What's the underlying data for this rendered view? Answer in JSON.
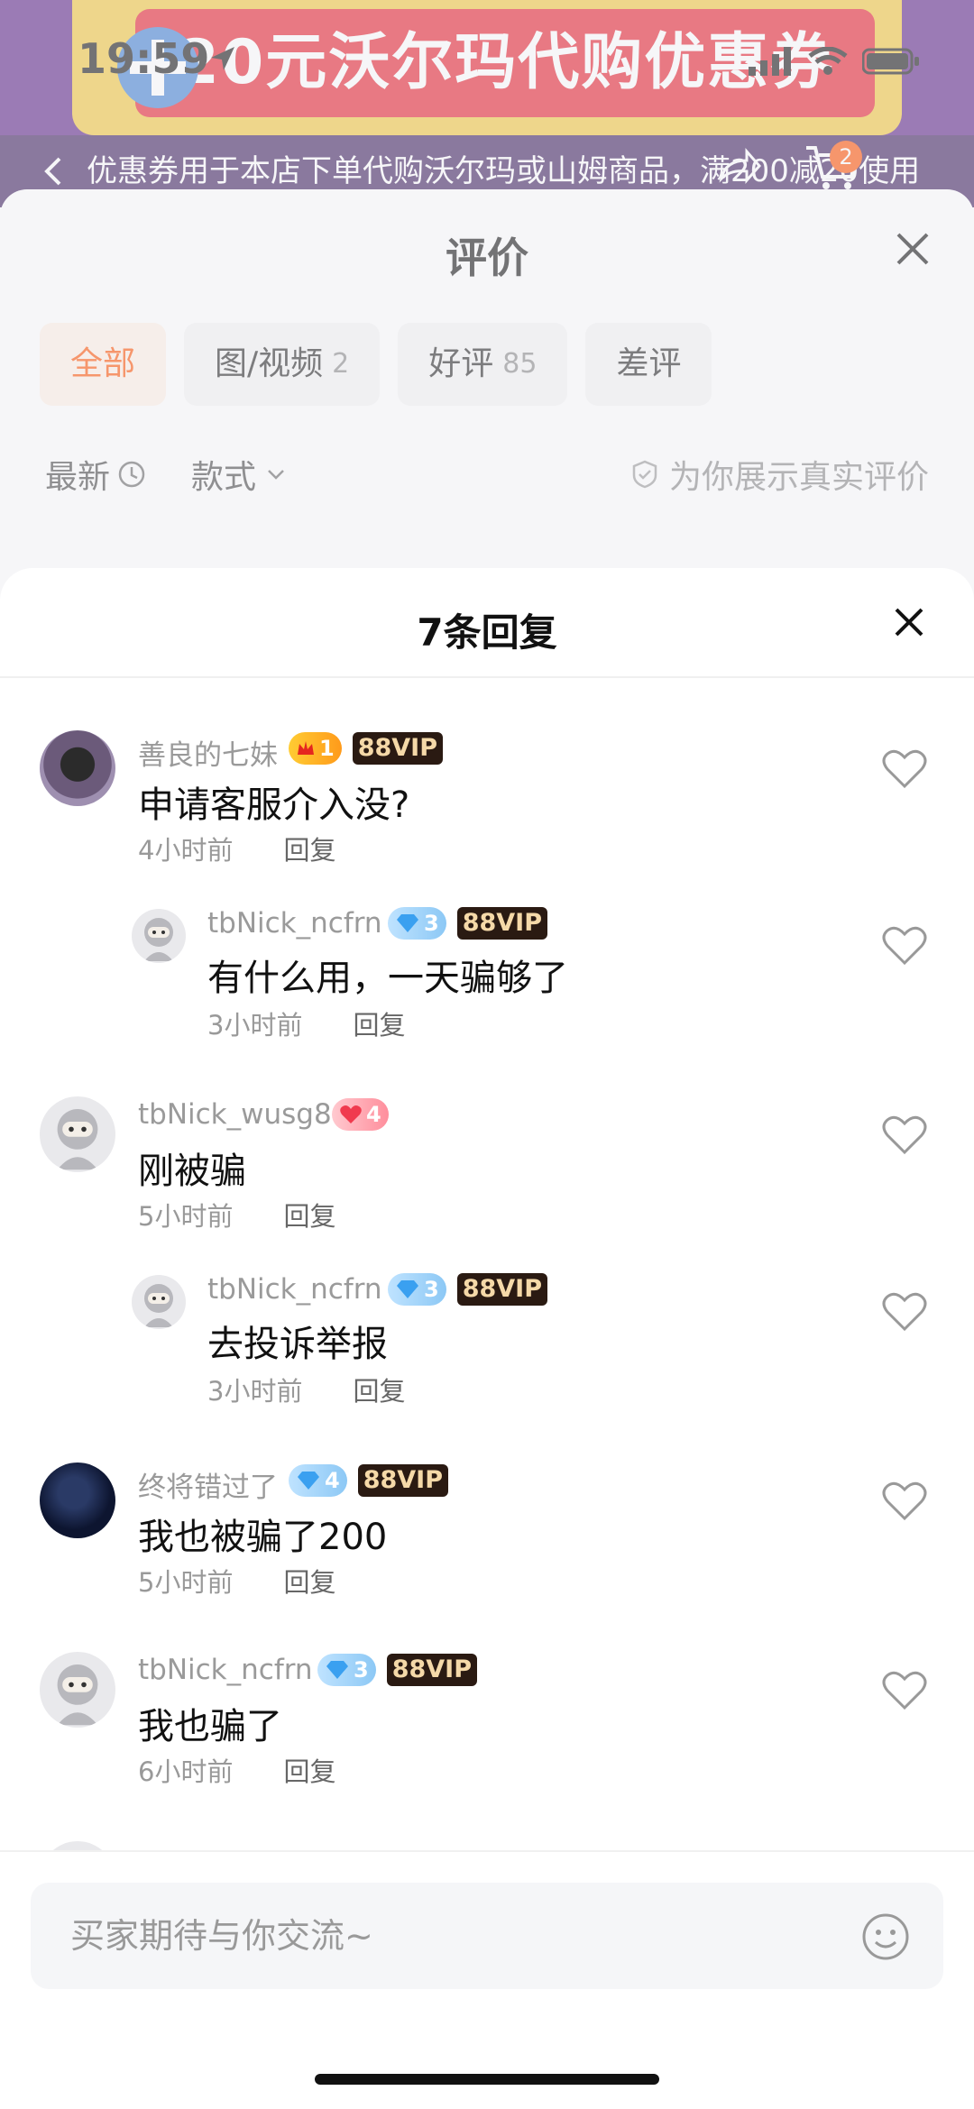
{
  "status_bar": {
    "time": "19:59"
  },
  "background": {
    "promo_banner": "20元沃尔玛代购优惠券",
    "subbar_text": "优惠券用于本店下单代购沃尔玛或山姆商品，满200减20使用",
    "cart_count": "2",
    "review_sheet": {
      "title": "评价",
      "tabs": [
        {
          "label": "全部",
          "count": ""
        },
        {
          "label": "图/视频",
          "count": "2"
        },
        {
          "label": "好评",
          "count": "85"
        },
        {
          "label": "差评",
          "count": ""
        }
      ],
      "filter_latest": "最新",
      "filter_style": "款式",
      "real_reviews": "为你展示真实评价"
    }
  },
  "reply_sheet": {
    "title": "7条回复",
    "comments": [
      {
        "user": "善良的七妹",
        "level": "1",
        "vip": "88VIP",
        "text": "申请客服介入没?",
        "time": "4小时前",
        "reply": "回复"
      },
      {
        "user": "tbNick_ncfrn",
        "level": "3",
        "vip": "88VIP",
        "text": "有什么用，一天骗够了",
        "time": "3小时前",
        "reply": "回复"
      },
      {
        "user": "tbNick_wusg8",
        "level": "4",
        "vip": "",
        "text": "刚被骗",
        "time": "5小时前",
        "reply": "回复"
      },
      {
        "user": "tbNick_ncfrn",
        "level": "3",
        "vip": "88VIP",
        "text": "去投诉举报",
        "time": "3小时前",
        "reply": "回复"
      },
      {
        "user": "终将错过了",
        "level": "4",
        "vip": "88VIP",
        "text": "我也被骗了200",
        "time": "5小时前",
        "reply": "回复"
      },
      {
        "user": "tbNick_ncfrn",
        "level": "3",
        "vip": "88VIP",
        "text": "我也骗了",
        "time": "6小时前",
        "reply": "回复"
      }
    ]
  },
  "input": {
    "placeholder": "买家期待与你交流~"
  },
  "colors": {
    "accent": "#ff5000",
    "vip_bg": "#2a1a12",
    "vip_text": "#f5d9a8"
  }
}
